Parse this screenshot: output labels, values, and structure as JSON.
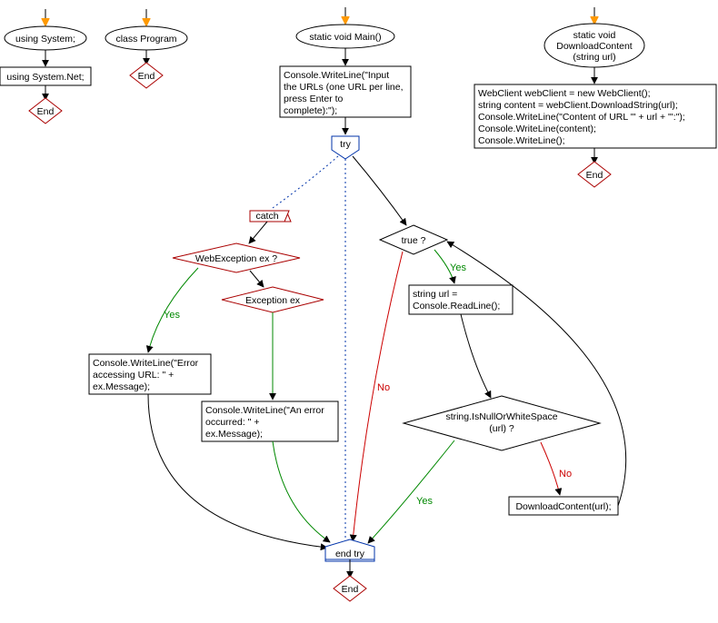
{
  "chart_data": {
    "type": "flowchart",
    "title": "",
    "flows": [
      {
        "name": "using-flow",
        "nodes": [
          {
            "id": "start1",
            "kind": "entry"
          },
          {
            "id": "n1",
            "kind": "ellipse",
            "text": "using System;"
          },
          {
            "id": "n2",
            "kind": "rect",
            "text": "using System.Net;"
          },
          {
            "id": "end1",
            "kind": "end",
            "text": "End"
          }
        ],
        "edges": [
          {
            "from": "start1",
            "to": "n1"
          },
          {
            "from": "n1",
            "to": "n2"
          },
          {
            "from": "n2",
            "to": "end1"
          }
        ]
      },
      {
        "name": "class-flow",
        "nodes": [
          {
            "id": "start2",
            "kind": "entry"
          },
          {
            "id": "n3",
            "kind": "ellipse",
            "text": "class Program"
          },
          {
            "id": "end2",
            "kind": "end",
            "text": "End"
          }
        ],
        "edges": [
          {
            "from": "start2",
            "to": "n3"
          },
          {
            "from": "n3",
            "to": "end2"
          }
        ]
      },
      {
        "name": "main-flow",
        "nodes": [
          {
            "id": "start3",
            "kind": "entry"
          },
          {
            "id": "m1",
            "kind": "ellipse",
            "text": "static void Main()"
          },
          {
            "id": "m2",
            "kind": "rect",
            "text": "Console.WriteLine(\"Input the URLs (one URL per line, press Enter to complete):\");"
          },
          {
            "id": "try",
            "kind": "try",
            "text": "try"
          },
          {
            "id": "catch",
            "kind": "catch",
            "text": "catch"
          },
          {
            "id": "d1",
            "kind": "decision-red",
            "text": "WebException ex ?"
          },
          {
            "id": "d2",
            "kind": "decision-red",
            "text": "Exception ex"
          },
          {
            "id": "m3",
            "kind": "rect",
            "text": "Console.WriteLine(\"Error accessing URL: \" + ex.Message);"
          },
          {
            "id": "m4",
            "kind": "rect",
            "text": "Console.WriteLine(\"An error occurred: \" + ex.Message);"
          },
          {
            "id": "d3",
            "kind": "decision",
            "text": "true ?"
          },
          {
            "id": "m5",
            "kind": "rect",
            "text": "string url = Console.ReadLine();"
          },
          {
            "id": "d4",
            "kind": "decision",
            "text": "string.IsNullOrWhiteSpace (url) ?"
          },
          {
            "id": "m6",
            "kind": "rect",
            "text": "DownloadContent(url);"
          },
          {
            "id": "endtry",
            "kind": "try",
            "text": "end try"
          },
          {
            "id": "end3",
            "kind": "end",
            "text": "End"
          }
        ],
        "edges": [
          {
            "from": "start3",
            "to": "m1"
          },
          {
            "from": "m1",
            "to": "m2"
          },
          {
            "from": "m2",
            "to": "try"
          },
          {
            "from": "try",
            "to": "catch",
            "style": "dotted"
          },
          {
            "from": "try",
            "to": "endtry",
            "style": "dotted"
          },
          {
            "from": "try",
            "to": "d3"
          },
          {
            "from": "catch",
            "to": "d1"
          },
          {
            "from": "d1",
            "to": "m3",
            "label": "Yes"
          },
          {
            "from": "d1",
            "to": "d2",
            "label": ""
          },
          {
            "from": "d2",
            "to": "m4",
            "label": ""
          },
          {
            "from": "m3",
            "to": "endtry"
          },
          {
            "from": "m4",
            "to": "endtry"
          },
          {
            "from": "d3",
            "to": "m5",
            "label": "Yes"
          },
          {
            "from": "d3",
            "to": "endtry",
            "label": "No"
          },
          {
            "from": "m5",
            "to": "d4"
          },
          {
            "from": "d4",
            "to": "endtry",
            "label": "Yes"
          },
          {
            "from": "d4",
            "to": "m6",
            "label": "No"
          },
          {
            "from": "m6",
            "to": "d3",
            "style": "back"
          },
          {
            "from": "endtry",
            "to": "end3"
          }
        ]
      },
      {
        "name": "download-flow",
        "nodes": [
          {
            "id": "start4",
            "kind": "entry"
          },
          {
            "id": "dl1",
            "kind": "ellipse",
            "text": "static void DownloadContent (string url)"
          },
          {
            "id": "dl2",
            "kind": "rect",
            "text": "WebClient webClient = new WebClient();\nstring content = webClient.DownloadString(url);\nConsole.WriteLine(\"Content of URL '\" + url + \"':\");\nConsole.WriteLine(content);\nConsole.WriteLine();"
          },
          {
            "id": "end4",
            "kind": "end",
            "text": "End"
          }
        ],
        "edges": [
          {
            "from": "start4",
            "to": "dl1"
          },
          {
            "from": "dl1",
            "to": "dl2"
          },
          {
            "from": "dl2",
            "to": "end4"
          }
        ]
      }
    ]
  },
  "nodes": {
    "usingSystem": "using System;",
    "usingNet": "using System.Net;",
    "classProgram": "class Program",
    "main": "static void Main()",
    "promptLine1": "Console.WriteLine(\"Input",
    "promptLine2": "the URLs (one URL per line,",
    "promptLine3": "press Enter to",
    "promptLine4": "complete):\");",
    "try": "try",
    "catch": "catch",
    "webEx": "WebException ex ?",
    "ex": "Exception ex",
    "errAccess1": "Console.WriteLine(\"Error",
    "errAccess2": "accessing URL: \" +",
    "errAccess3": "ex.Message);",
    "errOccur1": "Console.WriteLine(\"An error",
    "errOccur2": "occurred: \" +",
    "errOccur3": "ex.Message);",
    "trueQ": "true ?",
    "readLine1": "string url =",
    "readLine2": "Console.ReadLine();",
    "nullOrWs1": "string.IsNullOrWhiteSpace",
    "nullOrWs2": "(url) ?",
    "dlCall": "DownloadContent(url);",
    "endtry": "end try",
    "dlHead1": "static void",
    "dlHead2": "DownloadContent",
    "dlHead3": "(string url)",
    "dlBody1": "WebClient webClient = new WebClient();",
    "dlBody2": "string content = webClient.DownloadString(url);",
    "dlBody3": "Console.WriteLine(\"Content of URL '\" + url + \"':\");",
    "dlBody4": "Console.WriteLine(content);",
    "dlBody5": "Console.WriteLine();",
    "end": "End",
    "yes": "Yes",
    "no": "No"
  }
}
